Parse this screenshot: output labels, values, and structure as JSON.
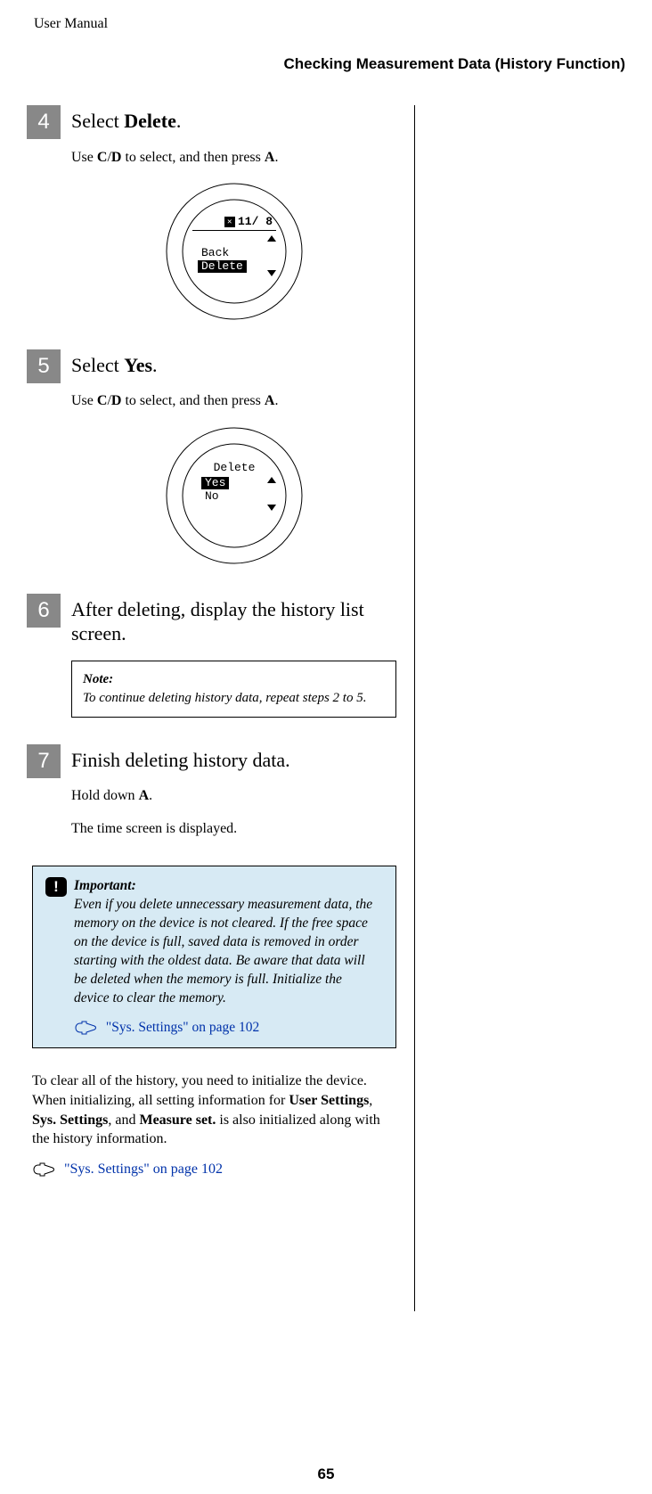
{
  "header_title": "User Manual",
  "section_title": "Checking Measurement Data (History Function)",
  "steps": {
    "s4": {
      "num": "4",
      "head_pre": "Select ",
      "head_bold": "Delete",
      "head_post": ".",
      "instr_pre": "Use ",
      "instr_b1": "C",
      "instr_slash": "/",
      "instr_b2": "D",
      "instr_mid": " to select, and then press ",
      "instr_b3": "A",
      "instr_end": ".",
      "lcd": {
        "date": "11/ 8",
        "line1": "Back",
        "line2": "Delete"
      }
    },
    "s5": {
      "num": "5",
      "head_pre": "Select ",
      "head_bold": "Yes",
      "head_post": ".",
      "instr_pre": "Use ",
      "instr_b1": "C",
      "instr_slash": "/",
      "instr_b2": "D",
      "instr_mid": " to select, and then press ",
      "instr_b3": "A",
      "instr_end": ".",
      "lcd": {
        "title": "Delete",
        "line1": "Yes",
        "line2": "No"
      }
    },
    "s6": {
      "num": "6",
      "head": "After deleting, display the history list screen.",
      "note_label": "Note:",
      "note_text": "To continue deleting history data, repeat steps 2 to 5."
    },
    "s7": {
      "num": "7",
      "head": "Finish deleting history data.",
      "line1_pre": "Hold down ",
      "line1_b": "A",
      "line1_post": ".",
      "line2": "The time screen is displayed."
    }
  },
  "important": {
    "label": "Important:",
    "text": "Even if you delete unnecessary measurement data, the memory on the device is not cleared. If the free space on the device is full, saved data is removed in order starting with the oldest data. Be aware that data will be deleted when the memory is full. Initialize the device to clear the memory.",
    "xref": "\"Sys. Settings\" on page 102"
  },
  "bottom": {
    "para_pre": "To clear all of the history, you need to initialize the device. When initializing, all setting information for ",
    "b1": "User Settings",
    "c1": ", ",
    "b2": "Sys. Settings",
    "c2": ", and ",
    "b3": "Measure set.",
    "para_post": " is also initialized along with the history information.",
    "xref": "\"Sys. Settings\" on page 102"
  },
  "page_number": "65"
}
